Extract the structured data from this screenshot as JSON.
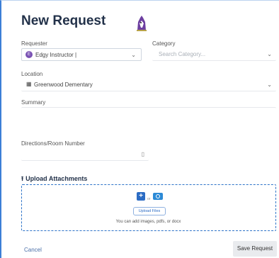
{
  "dialog": {
    "title": "New Request"
  },
  "requester": {
    "label": "Requester",
    "value": "Edgy Instructor |",
    "avatar_initial": "E"
  },
  "category": {
    "label": "Category",
    "placeholder": "Search Category..."
  },
  "location": {
    "label": "Location",
    "value": "Greenwood Dementary"
  },
  "summary": {
    "label": "Summary"
  },
  "directions": {
    "label": "Directions/Room Number"
  },
  "upload": {
    "title": "Upload Attachments",
    "or_text": "or",
    "button_label": "Upload Files",
    "hint": "You can add images, pdfs, or docx"
  },
  "footer": {
    "cancel_label": "Cancel",
    "save_label": "Save Request"
  },
  "colors": {
    "accent": "#2c6cc4",
    "title": "#23324a",
    "avatar": "#7a52b3"
  },
  "icons": {
    "logo": "mascot-logo",
    "location": "building-icon",
    "directions": "door-icon",
    "upload": "upload-arrow-icon",
    "add": "plus-icon",
    "camera": "camera-icon",
    "chevron": "chevron-down-icon"
  }
}
